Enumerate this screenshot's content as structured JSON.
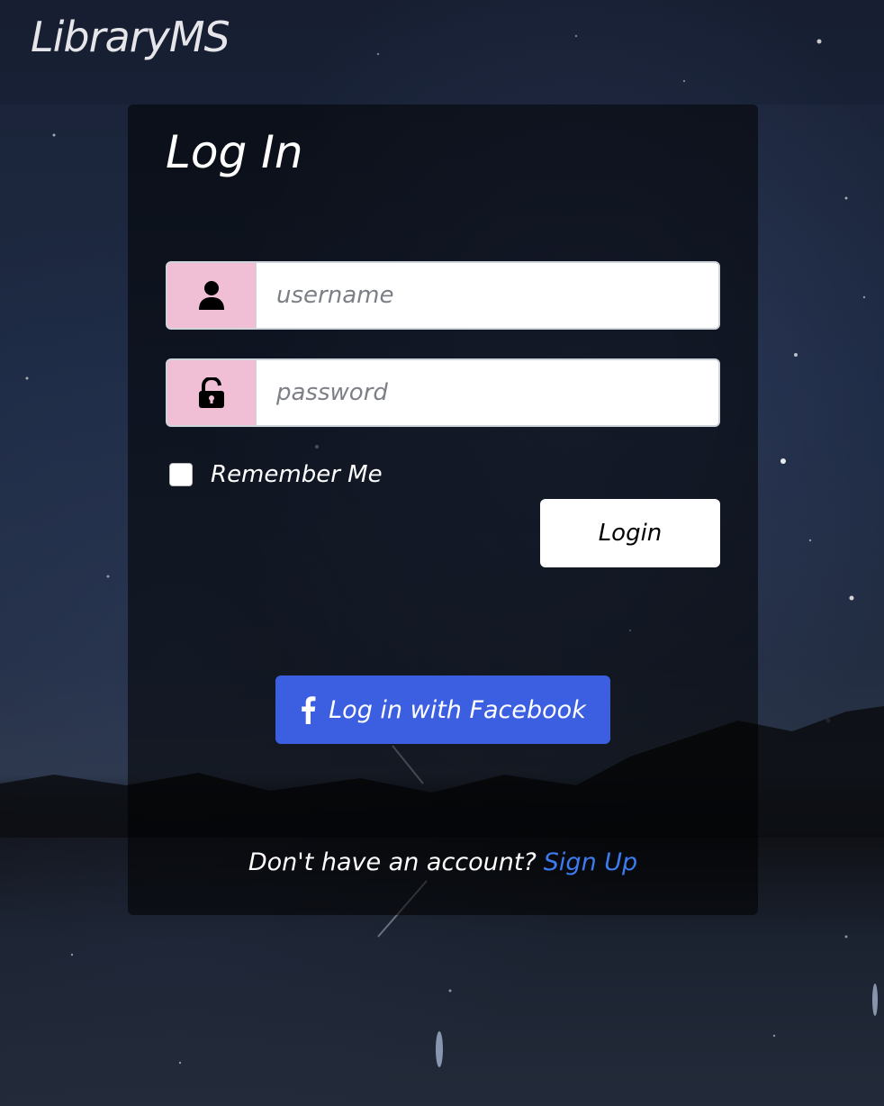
{
  "app": {
    "brand": "LibraryMS"
  },
  "login_card": {
    "title": "Log In",
    "username": {
      "placeholder": "username",
      "value": "",
      "icon": "user-icon"
    },
    "password": {
      "placeholder": "password",
      "value": "",
      "icon": "unlock-icon"
    },
    "remember_me": {
      "label": "Remember Me",
      "checked": false
    },
    "login_button": "Login",
    "facebook_button": {
      "label": "Log in with Facebook",
      "icon": "facebook-icon",
      "color": "#3b5fe0"
    },
    "footer": {
      "prompt": "Don't have an account?",
      "signup_link": "Sign Up",
      "link_color": "#3d7bf0"
    }
  },
  "colors": {
    "input_addon": "#f0bed5",
    "card_overlay": "rgba(0,0,0,0.55)"
  }
}
